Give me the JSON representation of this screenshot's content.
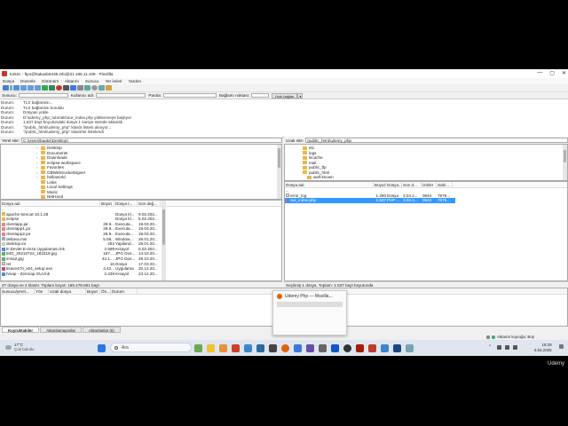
{
  "window": {
    "title": "turkric - ftp1@hakanb6435.info@31.186.11.109 - FileZilla",
    "minimize_glyph": "—",
    "maximize_glyph": "▢",
    "close_glyph": "✕"
  },
  "menu": [
    "Dosya",
    "Düzenle",
    "Görünüm",
    "Aktarım",
    "Sunucu",
    "Yer imleri",
    "Yardım"
  ],
  "quickconnect": {
    "host_label": "Sunucu:",
    "user_label": "Kullanıcı adı:",
    "pass_label": "Parola:",
    "port_label": "Bağlantı noktası:",
    "button": "Hızlı bağlan",
    "dropdown_glyph": "▾"
  },
  "log": [
    {
      "k": "Durum:",
      "v": "TLS bağlantısı..."
    },
    {
      "k": "Durum:",
      "v": "TLS bağlantısı kuruldu"
    },
    {
      "k": "Durum:",
      "v": "Dosyası yükle"
    },
    {
      "k": "Durum:",
      "v": "D:\\udemy_php_tutorials\\our_index.php yüklenmeye başlıyor"
    },
    {
      "k": "Durum:",
      "v": "1.537 bayt boyutundaki dosya 1 saniye sürede aktarıldı"
    },
    {
      "k": "Durum:",
      "v": "\"/public_html/udemy_php\" klasör listesi alınıyor..."
    },
    {
      "k": "Durum:",
      "v": "\"/public_html/udemy_php\" klasörler listelendi"
    }
  ],
  "local": {
    "path_label": "Yerel site:",
    "path": "C:\\Users\\baaks\\Desktop\\",
    "tree": [
      "Desktop",
      "Documents",
      "Downloads",
      "eclipse-workspace",
      "Favorites",
      "GBWebSocketSigner",
      "helloworld",
      "Links",
      "Local Settings",
      "Music",
      "NetHood"
    ],
    "tree_expand_glyph": "›",
    "columns": [
      "Dosya adı",
      "Boyut",
      "Dosya t...",
      "Son değ..."
    ],
    "files": [
      {
        "name": "..",
        "size": "",
        "type": "",
        "date": ""
      },
      {
        "name": "apache-tomcat-10.1.28",
        "size": "",
        "type": "Dosya kl...",
        "date": "9.02.202..."
      },
      {
        "name": "eclipse",
        "size": "",
        "type": "Dosya kl...",
        "date": "5.02.202..."
      },
      {
        "name": "clientapp.jar",
        "size": "28.9...",
        "type": "Executa...",
        "date": "19.03.20..."
      },
      {
        "name": "clientapp1.jar",
        "size": "28.9...",
        "type": "Executa...",
        "date": "18.03.20..."
      },
      {
        "name": "clientapp2.jar",
        "size": "28.9...",
        "type": "Executa...",
        "date": "19.03.20..."
      },
      {
        "name": "deltava.msi",
        "size": "5.06...",
        "type": "Window...",
        "date": "26.01.20..."
      },
      {
        "name": "desktop.ini",
        "size": "282",
        "type": "Yapiland...",
        "date": "28.01.20..."
      },
      {
        "name": "E-Devlet E-imza Uygulaması.lnk",
        "size": "2.598",
        "type": "Kısayol",
        "date": "5.03.202..."
      },
      {
        "name": "IMG_20210722_183319.jpg",
        "size": "167....",
        "type": "JPG Dos...",
        "date": "14.10.20..."
      },
      {
        "name": "imsa2.jpg",
        "size": "42.1....",
        "type": "JPG Dos...",
        "date": "28.10.20..."
      },
      {
        "name": "ret",
        "size": "16",
        "type": "Dosya",
        "date": "17.03.20..."
      },
      {
        "name": "ksave470_x64_setup.exe",
        "size": "4.42...",
        "type": "Uygulama",
        "date": "20.12.20..."
      },
      {
        "name": "hmap - Zenmap GUI.lnk",
        "size": "2.239",
        "type": "Kısayol",
        "date": "23.12.20..."
      }
    ],
    "status": "27 dosya ve 2 klasör. Toplam boyut: 165.478.591 bayt"
  },
  "remote": {
    "path_label": "Uzak site:",
    "path": "/public_html/udemy_php",
    "tree": [
      "etc",
      "logs",
      "lscache",
      "mail",
      "public_ftp",
      "public_html",
      "well-known"
    ],
    "columns": [
      "Dosya adı",
      "Boyut",
      "Dosya...",
      "Son d...",
      "İzinler",
      "Sahi..."
    ],
    "files": [
      {
        "name": "..",
        "size": "",
        "type": "",
        "date": "",
        "perm": "",
        "owner": ""
      },
      {
        "name": "error_log",
        "size": "1.290",
        "type": "Dosya",
        "date": "3.04.2...",
        "perm": "0644",
        "owner": "7876..."
      },
      {
        "name": "our_index.php",
        "size": "1.537",
        "type": "PHP ...",
        "date": "3.04.2...",
        "perm": "0644",
        "owner": "7876..."
      }
    ],
    "status": "Seçilmiş 1 dosya. Toplam: 1.537 bayt boyutunda"
  },
  "queue": {
    "columns": [
      "Sunucu/yerel...",
      "Yön",
      "Uzak dosya",
      "Boyut",
      "Ön...",
      "Durum"
    ],
    "tabs": [
      "Kuyruktakiler",
      "Aktarılamayanlar",
      "Aktarılanlar (6)"
    ],
    "status_right": "Aktarım kuyruğu: Boş"
  },
  "popup": {
    "title": "Udemy Php — Mozilla..."
  },
  "taskbar": {
    "weather_temp": "17°C",
    "weather_desc": "Çok bulutlu",
    "search_label": "Ara",
    "time": "16:29",
    "date": "6.04.2025",
    "tray_up_glyph": "⌃"
  },
  "watermark": "Udemy",
  "colors": {
    "selection": "#3399ff",
    "folder": "#e8b64c",
    "brand": "#c0392b"
  }
}
